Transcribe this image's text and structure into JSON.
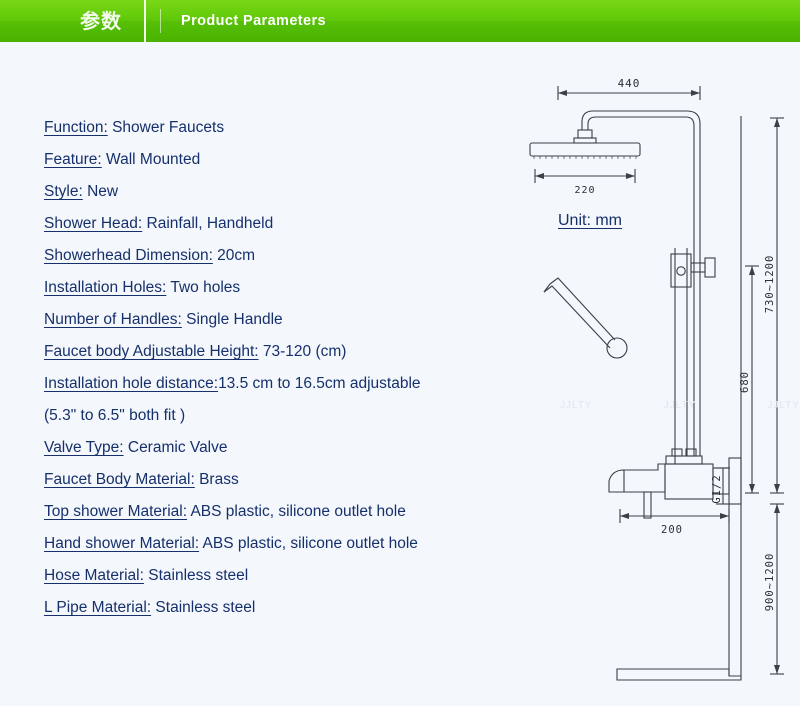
{
  "header": {
    "cn_label": "参数",
    "title": "Product Parameters",
    "gradient_top": "#7ad816",
    "gradient_bottom": "#49b300"
  },
  "page": {
    "background": "#f4f7fc",
    "text_color": "#16306b"
  },
  "specs": [
    {
      "label": "Function:",
      "value": " Shower Faucets"
    },
    {
      "label": "Feature:",
      "value": " Wall Mounted"
    },
    {
      "label": "Style:",
      "value": " New"
    },
    {
      "label": "Shower Head:",
      "value": " Rainfall, Handheld"
    },
    {
      "label": "Showerhead Dimension:",
      "value": " 20cm"
    },
    {
      "label": "Installation Holes:",
      "value": " Two  holes"
    },
    {
      "label": "Number of Handles:",
      "value": " Single Handle"
    },
    {
      "label": "Faucet body Adjustable Height:",
      "value": " 73-120 (cm)"
    },
    {
      "label": "Installation hole distance:",
      "value": "13.5 cm to 16.5cm adjustable"
    },
    {
      "label": "",
      "value": "(5.3\" to 6.5\" both fit )"
    },
    {
      "label": "Valve Type:",
      "value": " Ceramic Valve"
    },
    {
      "label": "Faucet Body Material:",
      "value": " Brass"
    },
    {
      "label": "Top shower Material:",
      "value": " ABS plastic, silicone outlet hole"
    },
    {
      "label": "Hand shower Material:",
      "value": " ABS plastic, silicone outlet hole"
    },
    {
      "label": "Hose Material:",
      "value": " Stainless steel"
    },
    {
      "label": "L Pipe Material:",
      "value": " Stainless steel"
    }
  ],
  "drawing": {
    "unit_note": "Unit: mm",
    "dimensions": {
      "arm_reach": "440",
      "shower_head_width": "220",
      "slide_bar_travel": "730~1200",
      "riser_height": "680",
      "spout_reach": "200",
      "inlet_thread": "G1/2",
      "inlet_height": "900~1200"
    },
    "watermarks": [
      "JJLTY",
      "JJLTY",
      "JJLTY"
    ]
  }
}
